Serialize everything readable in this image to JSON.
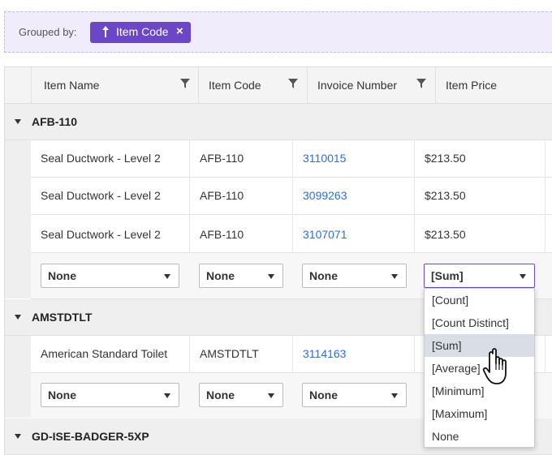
{
  "group_panel": {
    "label": "Grouped by:",
    "chip_label": "Item Code",
    "chip_close": "×"
  },
  "columns": [
    {
      "label": "Item Name"
    },
    {
      "label": "Item Code"
    },
    {
      "label": "Invoice Number"
    },
    {
      "label": "Item Price"
    }
  ],
  "groups": [
    {
      "name": "AFB-110",
      "rows": [
        {
          "item_name": "Seal Ductwork - Level 2",
          "item_code": "AFB-110",
          "invoice": "3110015",
          "price": "$213.50"
        },
        {
          "item_name": "Seal Ductwork - Level 2",
          "item_code": "AFB-110",
          "invoice": "3099263",
          "price": "$213.50"
        },
        {
          "item_name": "Seal Ductwork - Level 2",
          "item_code": "AFB-110",
          "invoice": "3107071",
          "price": "$213.50"
        }
      ],
      "aggregates": [
        "None",
        "None",
        "None",
        "[Sum]"
      ]
    },
    {
      "name": "AMSTDTLT",
      "rows": [
        {
          "item_name": "American Standard Toilet",
          "item_code": "AMSTDTLT",
          "invoice": "3114163",
          "price": ""
        }
      ],
      "aggregates": [
        "None",
        "None",
        "None"
      ]
    },
    {
      "name": "GD-ISE-BADGER-5XP",
      "rows": [],
      "aggregates": []
    }
  ],
  "aggregate_dropdown": {
    "options": [
      "[Count]",
      "[Count Distinct]",
      "[Sum]",
      "[Average]",
      "[Minimum]",
      "[Maximum]",
      "None"
    ],
    "highlighted": "[Sum]"
  },
  "colors": {
    "accent": "#6b47c8",
    "link": "#2f6fd6",
    "group_panel_bg": "#f1ecfb"
  }
}
